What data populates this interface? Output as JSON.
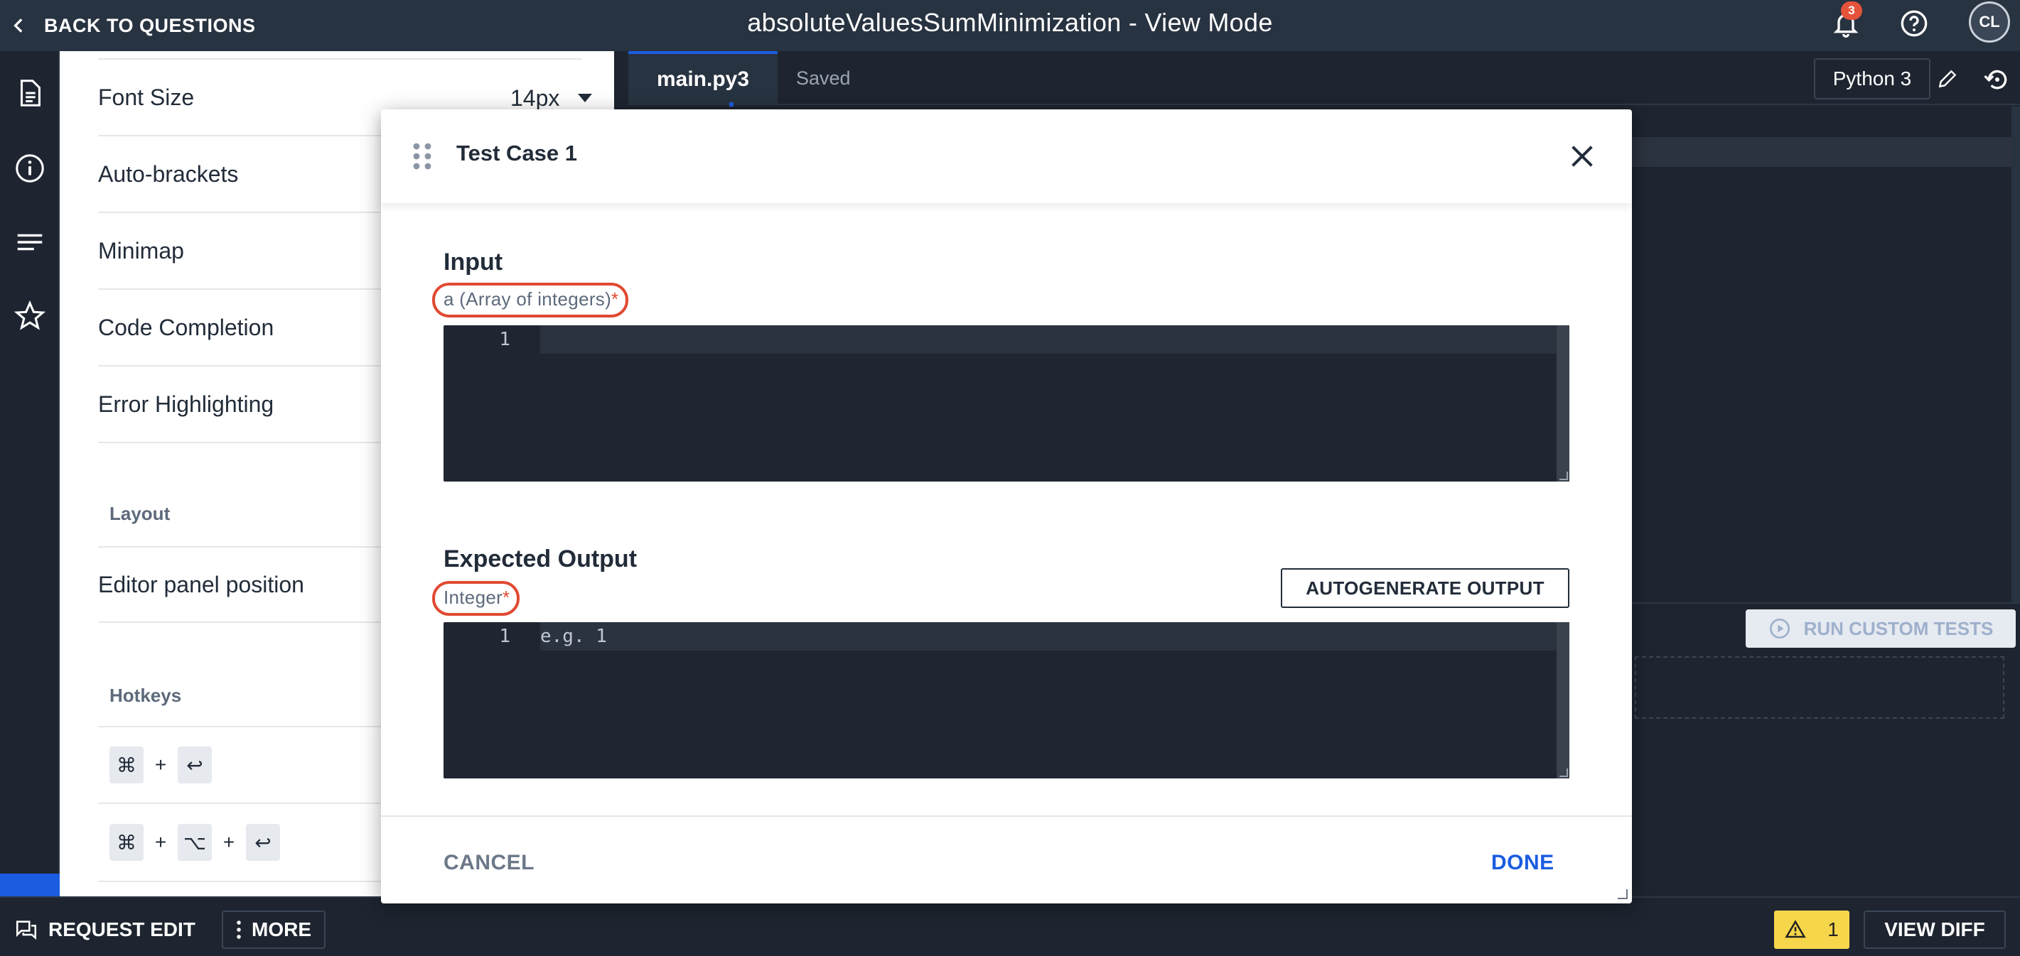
{
  "header": {
    "back_label": "BACK TO QUESTIONS",
    "title": "absoluteValuesSumMinimization - View Mode",
    "notification_count": "3",
    "avatar_initials": "CL"
  },
  "settings": {
    "font_size_label": "Font Size",
    "font_size_value": "14px",
    "rows": [
      "Auto-brackets",
      "Minimap",
      "Code Completion",
      "Error Highlighting"
    ],
    "layout_section": "Layout",
    "editor_panel_position": "Editor panel position",
    "hotkeys_section": "Hotkeys",
    "hotkeys": [
      [
        "⌘",
        "+",
        "↩"
      ],
      [
        "⌘",
        "+",
        "⌥",
        "+",
        "↩"
      ]
    ]
  },
  "editor": {
    "tab_label": "main.py3",
    "saved_label": "Saved",
    "language": "Python 3",
    "run_custom_tests_label": "RUN CUSTOM TESTS"
  },
  "modal": {
    "title": "Test Case 1",
    "input_title": "Input",
    "input_label": "a (Array of integers)",
    "required_mark": "*",
    "input_line_number": "1",
    "input_value": "",
    "output_title": "Expected Output",
    "output_label": "Integer",
    "output_line_number": "1",
    "output_placeholder": "e.g. 1",
    "autogenerate_label": "AUTOGENERATE OUTPUT",
    "cancel_label": "CANCEL",
    "done_label": "DONE"
  },
  "footer": {
    "request_edit_label": "REQUEST EDIT",
    "more_label": "MORE",
    "warning_count": "1",
    "view_diff_label": "VIEW DIFF"
  },
  "colors": {
    "accent": "#1b5ce0",
    "highlight_circle": "#e04a32",
    "warning": "#f6d64a"
  }
}
